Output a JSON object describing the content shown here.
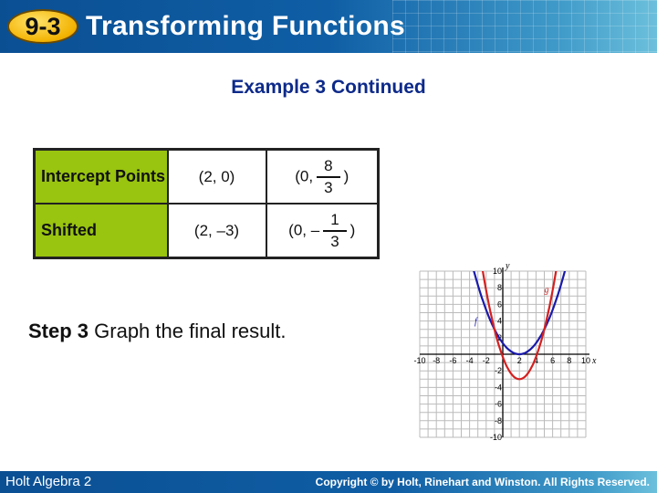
{
  "header": {
    "lesson_number": "9-3",
    "title": "Transforming Functions"
  },
  "subtitle": "Example 3 Continued",
  "table": {
    "rows": [
      {
        "label": "Intercept Points",
        "c1": "(2,  0)",
        "c2_prefix": "(0,",
        "c2_num": "8",
        "c2_den": "3",
        "c2_suffix": ")"
      },
      {
        "label": "Shifted",
        "c1": "(2, –3)",
        "c2_prefix": "(0, –",
        "c2_num": "1",
        "c2_den": "3",
        "c2_suffix": ")"
      }
    ]
  },
  "step": {
    "bold": "Step 3",
    "text": " Graph the final result."
  },
  "chart_data": {
    "type": "line",
    "xlabel": "x",
    "ylabel": "y",
    "xlim": [
      -10,
      10
    ],
    "ylim": [
      -10,
      10
    ],
    "grid": true,
    "x_ticks": [
      "-10",
      "-8",
      "-6",
      "-4",
      "-2",
      "2",
      "4",
      "6",
      "8",
      "10"
    ],
    "y_ticks": [
      "10",
      "8",
      "6",
      "4",
      "2",
      "-2",
      "-4",
      "-6",
      "-8",
      "-10"
    ],
    "series": [
      {
        "name": "f",
        "color": "#1a1aaa",
        "vertex": [
          2,
          0
        ],
        "a": 0.3333,
        "points": [
          [
            -4,
            12
          ],
          [
            -1,
            3
          ],
          [
            0,
            1.33
          ],
          [
            2,
            0
          ],
          [
            4,
            1.33
          ],
          [
            5,
            3
          ],
          [
            8,
            12
          ]
        ]
      },
      {
        "name": "g",
        "color": "#d42020",
        "vertex": [
          2,
          -3
        ],
        "a": 0.6667,
        "points": [
          [
            -2,
            7.67
          ],
          [
            -1,
            3
          ],
          [
            0,
            -0.33
          ],
          [
            2,
            -3
          ],
          [
            4,
            -0.33
          ],
          [
            5,
            3
          ],
          [
            6,
            7.67
          ]
        ]
      }
    ]
  },
  "footer": {
    "left": "Holt Algebra 2",
    "right": "Copyright © by Holt, Rinehart and Winston. All Rights Reserved."
  }
}
